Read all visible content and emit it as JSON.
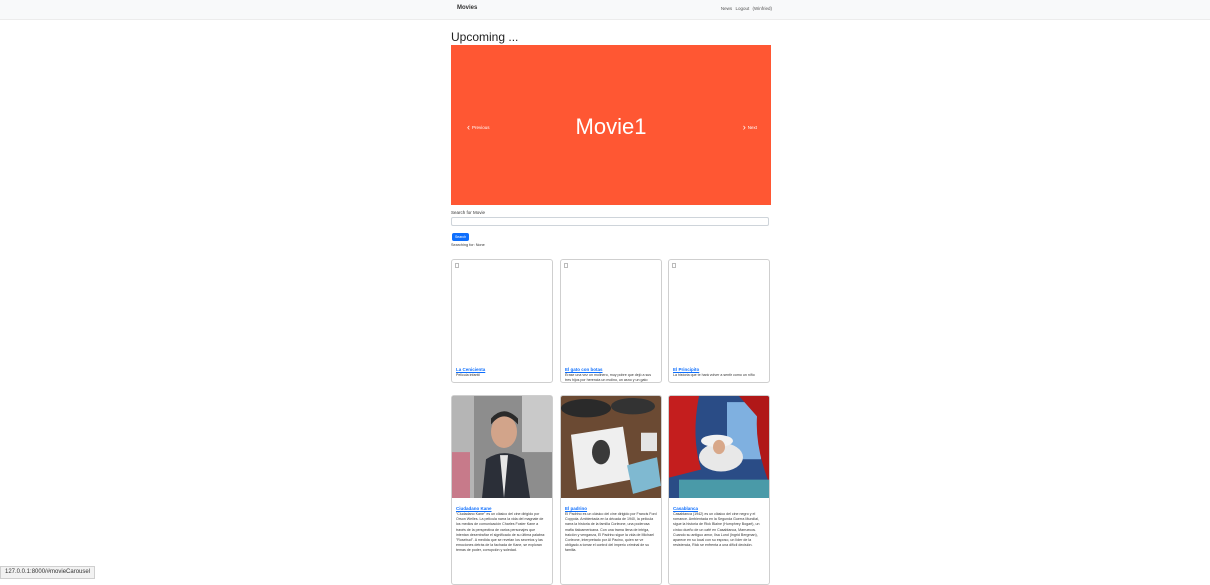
{
  "navbar": {
    "brand": "Movies",
    "links": [
      "News",
      "Logout",
      "(Winfried)"
    ]
  },
  "page": {
    "heading": "Upcoming ..."
  },
  "carousel": {
    "slide_title": "Movie1",
    "slide_color": "#ff5733",
    "prev_label": "Previous",
    "next_label": "Next"
  },
  "search": {
    "label": "Search for Movie",
    "value": "",
    "button_label": "Search",
    "status": "Searching for: None"
  },
  "movies": [
    {
      "title": "La Cenicienta",
      "text": "Pelicula infantil"
    },
    {
      "title": "El gato con botas",
      "text": "Érase una vez un molinero, muy pobre que dejó a sus tres hijos por herencia un molino, un asno y un gato"
    },
    {
      "title": "El Principito",
      "text": "La historia que te hará volver a sentir como un niño"
    },
    {
      "title": "Ciudadano Kane",
      "text": "\"Ciudadano Kane\" es un clásico del cine dirigido por Orson Welles. La película narra la vida del magnate de los medios de comunicación Charles Foster Kane a través de la perspectiva de varios personajes que intentan desentrañar el significado de su última palabra: \"Rosebud\". A medida que se revelan los secretos y las emociones detrás de la fachada de Kane, se exploran temas de poder, corrupción y soledad."
    },
    {
      "title": "El padrino",
      "text": "El Padrino es un clásico del cine dirigido por Francis Ford Coppola. Ambientada en la década de 1940, la película narra la historia de la familia Corleone, una poderosa mafia italoamericana. Con una trama llena de intriga, traición y venganza, El Padrino sigue la vida de Michael Corleone, interpretado por Al Pacino, quien se ve obligado a tomar el control del imperio criminal de su familia."
    },
    {
      "title": "Casablanca",
      "text": "Casablanca (1942) es un clásico del cine negro y el romance. Ambientada en la Segunda Guerra Mundial, sigue la historia de Rick Blaine (Humphrey Bogart), un cínico dueño de un café en Casablanca, Marruecos. Cuando su antiguo amor, Ilsa Lund (Ingrid Bergman), aparece en su local con su esposo, un líder de la resistencia, Rick se enfrenta a una difícil decisión."
    }
  ],
  "statusbar": {
    "url": "127.0.0.1:8000/#movieCarousel"
  }
}
